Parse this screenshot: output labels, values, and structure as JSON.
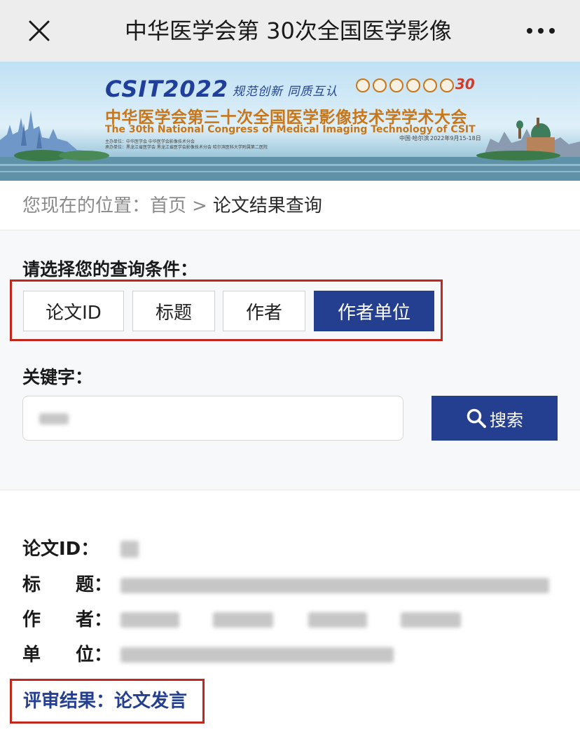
{
  "window": {
    "title": "中华医学会第 30次全国医学影像",
    "close_icon": "close-icon",
    "more_icon": "more-icon"
  },
  "banner": {
    "logo": "CSIT2022",
    "slogan": "规范创新  同质互认",
    "title_cn": "中华医学会第三十次全国医学影像技术学学术大会",
    "title_en": "The 30th National Congress of Medical Imaging Technology of CSIT",
    "organizer_line1": "主办单位：中华医学会  中华医学会影像技术分会",
    "organizer_line2": "承办单位：黑龙江省医学会  黑龙江省医学会影像技术分会  哈尔滨医科大学附属第二医院",
    "city": "中国·哈尔滨",
    "date": "2022年9月15-18日",
    "anniversary": "30"
  },
  "breadcrumb": {
    "prefix": "您现在的位置：",
    "home": "首页",
    "separator": ">",
    "current": "论文结果查询"
  },
  "query": {
    "label": "请选择您的查询条件：",
    "options": [
      {
        "label": "论文ID",
        "selected": false
      },
      {
        "label": "标题",
        "selected": false
      },
      {
        "label": "作者",
        "selected": false
      },
      {
        "label": "作者单位",
        "selected": true
      }
    ],
    "keyword_label": "关键字：",
    "keyword_value": "",
    "search_label": "搜索",
    "search_icon": "search-icon"
  },
  "result": {
    "id_label": "论文ID：",
    "title_label_a": "标",
    "title_label_b": "题：",
    "author_label_a": "作",
    "author_label_b": "者：",
    "unit_label_a": "单",
    "unit_label_b": "位：",
    "id_value": "",
    "title_value": "",
    "authors": [
      "",
      "",
      "",
      ""
    ],
    "unit_value": "",
    "review_label": "评审结果：",
    "review_value": "论文发言"
  },
  "colors": {
    "accent": "#243f8f",
    "highlight_box": "#c0281e",
    "banner_text": "#c8761a"
  }
}
